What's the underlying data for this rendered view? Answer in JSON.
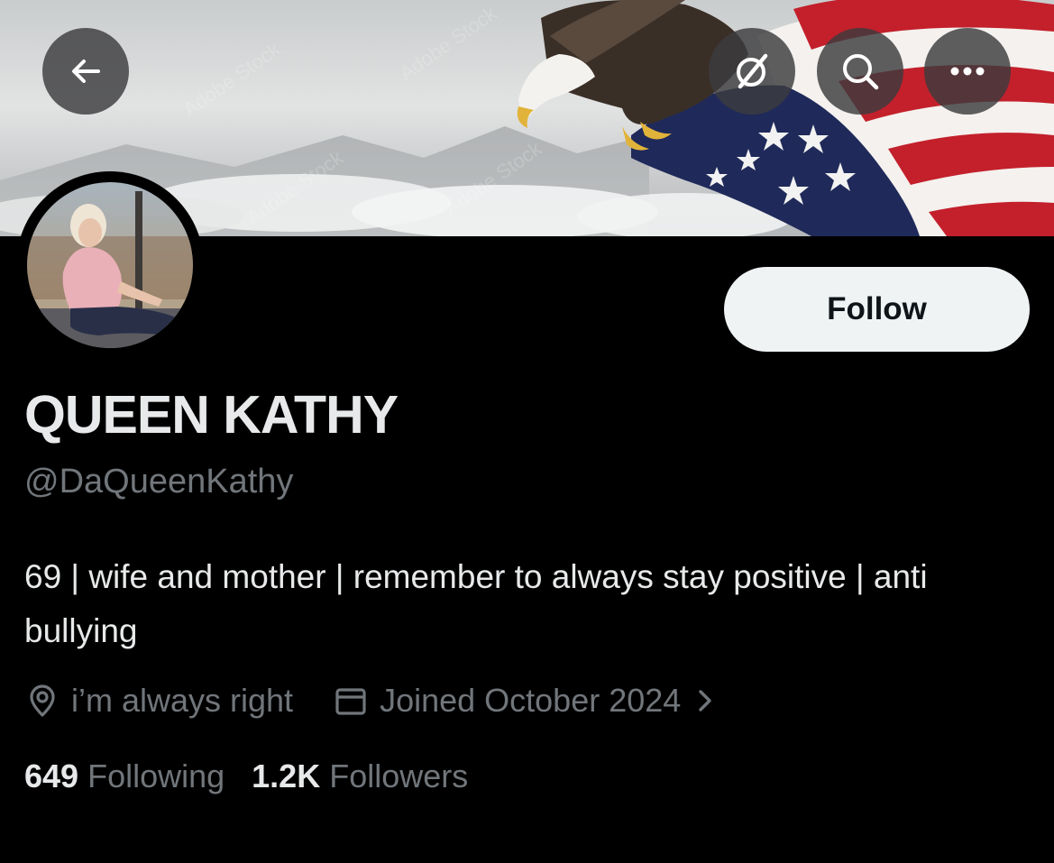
{
  "header": {
    "back_icon": "arrow-left-icon",
    "grok_icon": "grok-slash-icon",
    "search_icon": "search-icon",
    "more_icon": "more-horizontal-icon"
  },
  "profile": {
    "display_name": "QUEEN KATHY",
    "handle": "@DaQueenKathy",
    "bio": "69 | wife and mother | remember to always stay positive | anti bullying",
    "location": "i’m always right",
    "joined": "Joined October 2024",
    "following_count": "649",
    "following_label": "Following",
    "followers_count": "1.2K",
    "followers_label": "Followers"
  },
  "actions": {
    "follow_label": "Follow"
  },
  "colors": {
    "background": "#000000",
    "primary_text": "#e7e9ea",
    "secondary_text": "#71767b",
    "follow_button": "#eff3f4"
  }
}
